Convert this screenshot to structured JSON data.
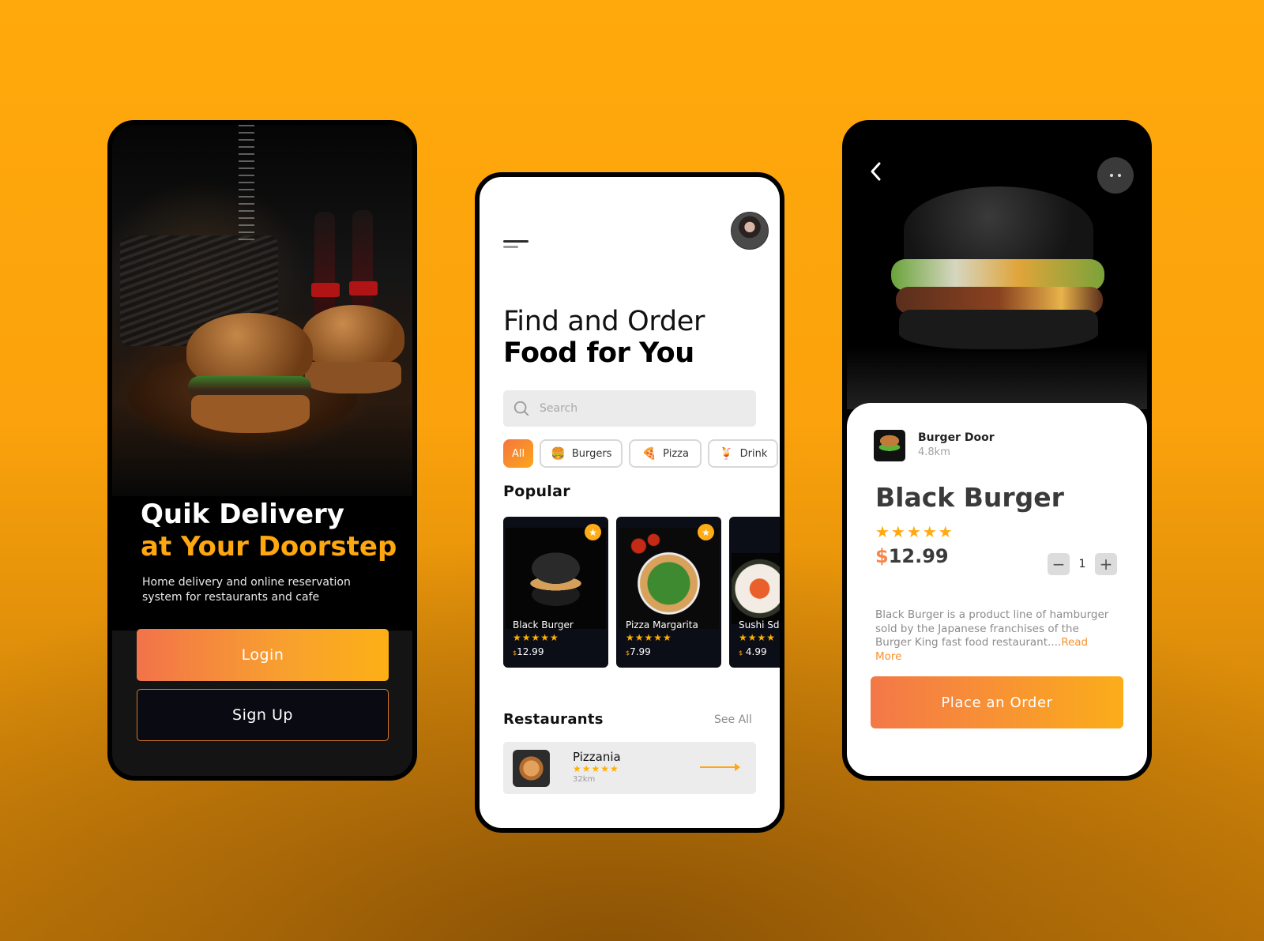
{
  "colors": {
    "accent": "#ffa710",
    "gradient_start": "#f2734a",
    "gradient_end": "#fcb016",
    "star": "#ffb000"
  },
  "welcome_screen": {
    "title_line1": "Quik Delivery",
    "title_line2": "at Your Doorstep",
    "description": "Home delivery and online reservation system for restaurants and cafe",
    "login_label": "Login",
    "signup_label": "Sign Up"
  },
  "home_screen": {
    "menu_icon": "hamburger-menu-icon",
    "avatar": "user-avatar",
    "heading_line1": "Find and Order",
    "heading_line2": "Food for You",
    "search": {
      "placeholder": "Search",
      "value": "",
      "icon": "search-icon"
    },
    "categories": [
      {
        "label": "All",
        "emoji": "",
        "active": true
      },
      {
        "label": "Burgers",
        "emoji": "🍔",
        "active": false
      },
      {
        "label": "Pizza",
        "emoji": "🍕",
        "active": false
      },
      {
        "label": "Drink",
        "emoji": "🍹",
        "active": false
      }
    ],
    "popular_title": "Popular",
    "popular": [
      {
        "name": "Black Burger",
        "stars": "★★★★★",
        "currency": "$",
        "price": "12.99",
        "rating": 5,
        "favorite": true
      },
      {
        "name": "Pizza Margarita",
        "stars": "★★★★★",
        "currency": "$",
        "price": "7.99",
        "rating": 5,
        "favorite": true
      },
      {
        "name": "Sushi Sd",
        "stars": "★★★★",
        "currency": "$",
        "price": " 4.99",
        "rating": 5,
        "favorite": false
      }
    ],
    "restaurants_title": "Restaurants",
    "see_all_label": "See All",
    "restaurants": [
      {
        "name": "Pizzania",
        "stars": "★★★★★",
        "rating": 5,
        "distance": "32km"
      }
    ]
  },
  "detail_screen": {
    "shop_name": "Burger Door",
    "shop_distance": "4.8km",
    "product_name": "Black Burger",
    "stars": "★★★★★",
    "rating": 5,
    "currency": "$",
    "price": "12.99",
    "quantity": "1",
    "minus_label": "−",
    "plus_label": "+",
    "description": "Black Burger is a product line of hamburger sold by the Japanese franchises of the Burger King fast food restaurant....",
    "read_more_label": "Read More",
    "order_label": "Place an Order"
  }
}
